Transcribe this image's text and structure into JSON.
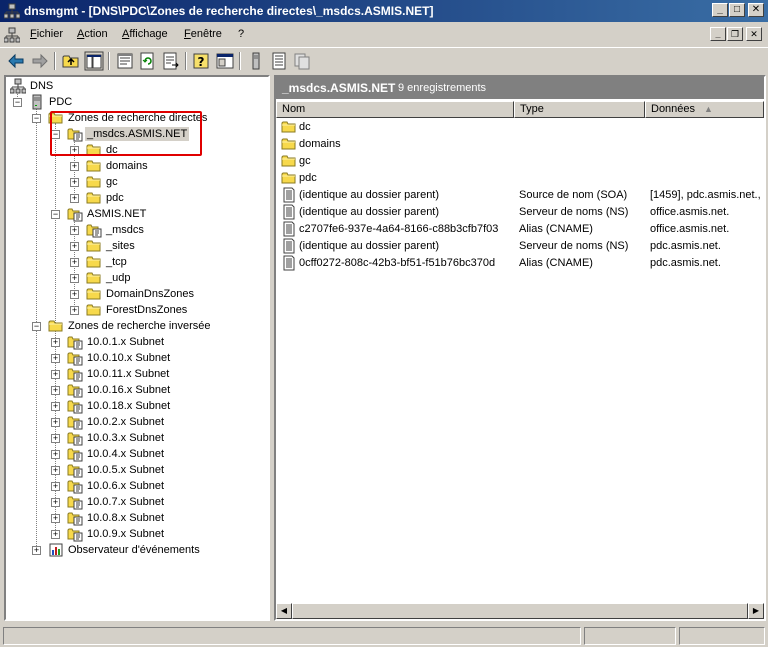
{
  "window": {
    "title": "dnsmgmt - [DNS\\PDC\\Zones de recherche directes\\_msdcs.ASMIS.NET]",
    "minimize": "_",
    "maximize": "□",
    "close": "✕"
  },
  "menu": {
    "items": [
      "Fichier",
      "Action",
      "Affichage",
      "Fenêtre",
      "?"
    ],
    "mdi_minimize": "_",
    "mdi_restore": "❐",
    "mdi_close": "✕"
  },
  "toolbar": {
    "buttons": [
      "back-arrow-icon",
      "forward-arrow-icon",
      "up-folder-icon",
      "show-hide-tree-icon",
      "properties-icon",
      "refresh-icon",
      "export-list-icon",
      "help-icon",
      "console-pane-icon",
      "server-icon",
      "record-icon",
      "copy-icon"
    ]
  },
  "tree": {
    "dns": "DNS",
    "pdc": "PDC",
    "forward_zones": "Zones de recherche directes",
    "msdcs": "_msdcs.ASMIS.NET",
    "msdcs_children": [
      "dc",
      "domains",
      "gc",
      "pdc"
    ],
    "asmis": "ASMIS.NET",
    "asmis_children": [
      "_msdcs",
      "_sites",
      "_tcp",
      "_udp",
      "DomainDnsZones",
      "ForestDnsZones"
    ],
    "reverse_zones": "Zones de recherche inversée",
    "reverse_children": [
      "10.0.1.x Subnet",
      "10.0.10.x Subnet",
      "10.0.11.x Subnet",
      "10.0.16.x Subnet",
      "10.0.18.x Subnet",
      "10.0.2.x Subnet",
      "10.0.3.x Subnet",
      "10.0.4.x Subnet",
      "10.0.5.x Subnet",
      "10.0.6.x Subnet",
      "10.0.7.x Subnet",
      "10.0.8.x Subnet",
      "10.0.9.x Subnet"
    ],
    "event_viewer": "Observateur d'événements"
  },
  "list": {
    "title": "_msdcs.ASMIS.NET",
    "count": "9 enregistrements",
    "columns": [
      "Nom",
      "Type",
      "Données"
    ],
    "sort_indicator": "▲",
    "rows": [
      {
        "icon": "folder",
        "name": "dc",
        "type": "",
        "data": ""
      },
      {
        "icon": "folder",
        "name": "domains",
        "type": "",
        "data": ""
      },
      {
        "icon": "folder",
        "name": "gc",
        "type": "",
        "data": ""
      },
      {
        "icon": "folder",
        "name": "pdc",
        "type": "",
        "data": ""
      },
      {
        "icon": "record",
        "name": "(identique au dossier parent)",
        "type": "Source de nom (SOA)",
        "data": "[1459], pdc.asmis.net., ..."
      },
      {
        "icon": "record",
        "name": "(identique au dossier parent)",
        "type": "Serveur de noms (NS)",
        "data": "office.asmis.net."
      },
      {
        "icon": "record",
        "name": "c2707fe6-937e-4a64-8166-c88b3cfb7f03",
        "type": "Alias (CNAME)",
        "data": "office.asmis.net."
      },
      {
        "icon": "record",
        "name": "(identique au dossier parent)",
        "type": "Serveur de noms (NS)",
        "data": "pdc.asmis.net."
      },
      {
        "icon": "record",
        "name": "0cff0272-808c-42b3-bf51-f51b76bc370d",
        "type": "Alias (CNAME)",
        "data": "pdc.asmis.net."
      }
    ]
  },
  "colors": {
    "title_bar": "#0a246a",
    "highlight_box": "#e00000",
    "folder": "#f7d94c",
    "chrome": "#d4d0c8"
  }
}
